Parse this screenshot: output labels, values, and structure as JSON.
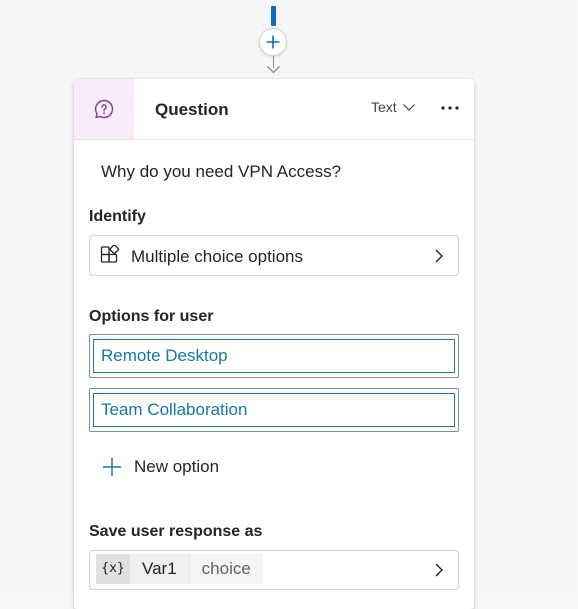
{
  "canvas": {
    "add_node_glyph": "+"
  },
  "node": {
    "title": "Question",
    "type_label": "Text",
    "icon": "question-bubble-icon",
    "accent_color": "#7d3e8a",
    "question_text": "Why do you need VPN Access?"
  },
  "identify": {
    "label": "Identify",
    "value": "Multiple choice options",
    "icon": "entity-blocks-icon"
  },
  "options": {
    "label": "Options for user",
    "items": [
      "Remote Desktop",
      "Team Collaboration"
    ],
    "new_option_label": "New option",
    "text_color": "#1578a3"
  },
  "save_response": {
    "label": "Save user response as",
    "var_icon": "{x}",
    "var_name": "Var1",
    "var_type": "choice"
  }
}
